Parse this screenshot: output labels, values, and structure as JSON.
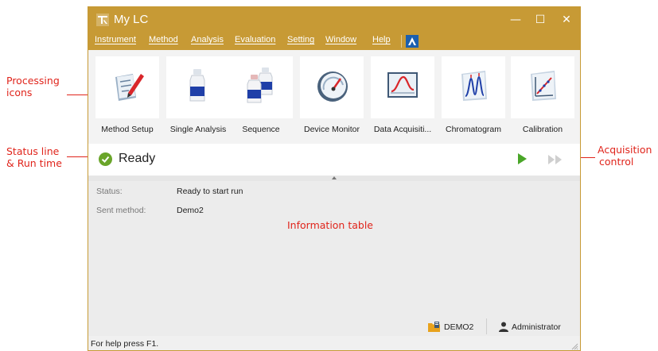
{
  "window": {
    "title": "My LC",
    "minimize": "—",
    "maximize": "☐",
    "close": "✕",
    "accent_color": "#c79a35"
  },
  "menu": [
    "Instrument",
    "Method",
    "Analysis",
    "Evaluation",
    "Setting",
    "Window",
    "Help"
  ],
  "tools": [
    {
      "label": "Method Setup",
      "icon": "method-setup-icon"
    },
    {
      "label": "Single Analysis",
      "icon": "single-analysis-icon"
    },
    {
      "label": "Sequence",
      "icon": "sequence-icon"
    },
    {
      "label": "Device Monitor",
      "icon": "device-monitor-icon"
    },
    {
      "label": "Data Acquisiti...",
      "icon": "data-acquisition-icon"
    },
    {
      "label": "Chromatogram",
      "icon": "chromatogram-icon"
    },
    {
      "label": "Calibration",
      "icon": "calibration-icon"
    }
  ],
  "status": {
    "text": "Ready",
    "color": "#6aa52a"
  },
  "info": {
    "rows": [
      {
        "key": "Status:",
        "value": "Ready to start run"
      },
      {
        "key": "Sent method:",
        "value": "Demo2"
      }
    ]
  },
  "bottom": {
    "project": "DEMO2",
    "user": "Administrator"
  },
  "help_text": "For help press F1.",
  "annotations": {
    "processing": [
      "Processing",
      "icons"
    ],
    "status": [
      "Status line",
      "& Run time"
    ],
    "acquisition": [
      "Acquisition",
      "control"
    ],
    "info_table": "Information table",
    "color": "#e0241b"
  }
}
